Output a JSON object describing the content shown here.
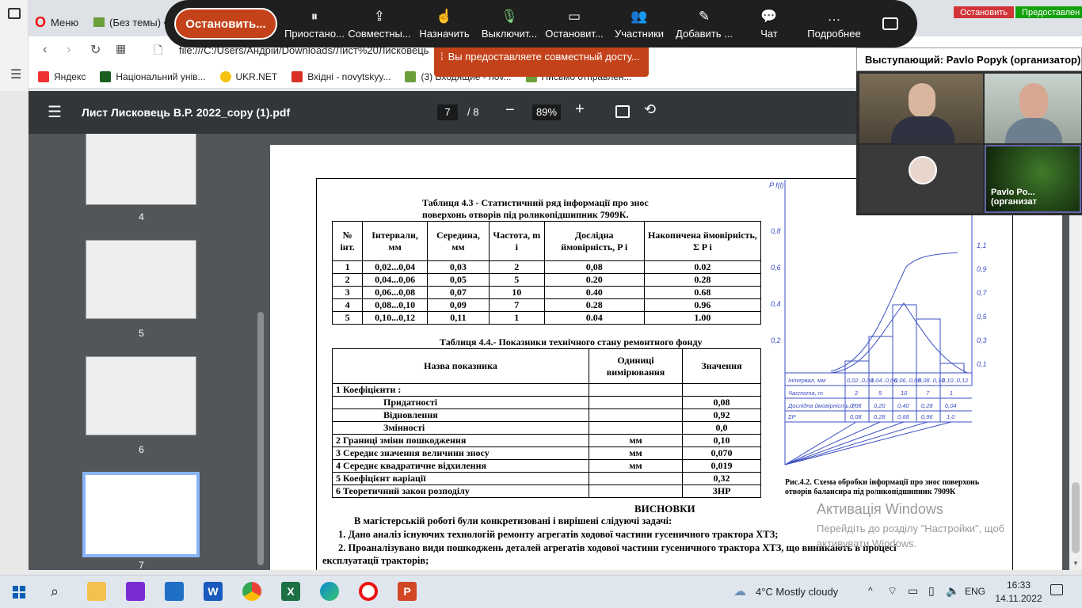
{
  "browser": {
    "tab1": "Меню",
    "tab2": "(Без темы) •",
    "address": "file:///C:/Users/Андрій/Downloads/Лист%20Лисковець",
    "bookmarks": [
      {
        "label": "Яндекс",
        "color": "#e33"
      },
      {
        "label": "Національний унів...",
        "color": "#1b5e20"
      },
      {
        "label": "UKR.NET",
        "color": "#f4c20d"
      },
      {
        "label": "Вхідні - novytskyy...",
        "color": "#d93025"
      },
      {
        "label": "(3) Входящие - nov...",
        "color": "#6a9f3a"
      },
      {
        "label": "Письмо отправлен...",
        "color": "#6a9f3a"
      }
    ]
  },
  "teams": {
    "stop_label": "Остановить...",
    "buttons": [
      {
        "icon": "pause-icon",
        "glyph": "⏸",
        "label": "Приостано..."
      },
      {
        "icon": "share-screen-icon",
        "glyph": "⇪",
        "label": "Совместны..."
      },
      {
        "icon": "assign-icon",
        "glyph": "☝",
        "label": "Назначить"
      },
      {
        "icon": "microphone-icon",
        "glyph": "🎙",
        "label": "Выключит..."
      },
      {
        "icon": "camera-icon",
        "glyph": "▭",
        "label": "Остановит..."
      },
      {
        "icon": "participants-icon",
        "glyph": "👥",
        "label": "Участники"
      },
      {
        "icon": "annotate-icon",
        "glyph": "✎",
        "label": "Добавить ..."
      },
      {
        "icon": "chat-icon",
        "glyph": "💬",
        "label": "Чат"
      },
      {
        "icon": "more-icon",
        "glyph": "…",
        "label": "Подробнее"
      }
    ],
    "share_banner": "Вы предоставляете совместный досту...",
    "top_stop": "Остановить",
    "top_share": "Предоставлен",
    "speaker_prefix": "Выступающий:",
    "speaker_name": "Pavlo Popyk (организатор)",
    "tile_name": "Pavlo Po... (организат"
  },
  "pdf": {
    "title": "Лист Лисковець В.Р. 2022_copy (1).pdf",
    "page_current": "7",
    "page_total": "/ 8",
    "zoom": "89%",
    "thumbs": [
      "4",
      "5",
      "6",
      "7"
    ]
  },
  "doc": {
    "table43_title1": "Таблиця 4.3 -  Статистичний ряд інформації про знос",
    "table43_title2": "поверхонь отворів під  роликопідшипник 7909К.",
    "table43_headers": [
      "№ інт.",
      "Інтервали, мм",
      "Середина, мм",
      "Частота, m i",
      "Дослідна ймовірність, P i",
      "Накопичена ймовірність, Σ P i"
    ],
    "table43_rows": [
      [
        "1",
        "0,02...0,04",
        "0,03",
        "2",
        "0,08",
        "0.02"
      ],
      [
        "2",
        "0,04...0,06",
        "0,05",
        "5",
        "0.20",
        "0.28"
      ],
      [
        "3",
        "0,06...0,08",
        "0,07",
        "10",
        "0.40",
        "0.68"
      ],
      [
        "4",
        "0,08...0,10",
        "0,09",
        "7",
        "0.28",
        "0.96"
      ],
      [
        "5",
        "0,10...0,12",
        "0,11",
        "1",
        "0.04",
        "1.00"
      ]
    ],
    "table44_title": "Таблиця 4.4.- Показники технічного стану ремонтного фонду",
    "table44_headers": [
      "Назва показника",
      "Одиниці вимірювання",
      "Значення"
    ],
    "table44_rows": [
      [
        "1  Коефіцієнти :",
        "",
        ""
      ],
      [
        "Придатності",
        "",
        "0,08"
      ],
      [
        "Відновлення",
        "",
        "0,92"
      ],
      [
        "Змінності",
        "",
        "0,0"
      ],
      [
        "2  Границі зміни пошкодження",
        "мм",
        "0,10"
      ],
      [
        "3  Середнє значення величини зносу",
        "мм",
        "0,070"
      ],
      [
        "4  Середнє квадратичне відхилення",
        "мм",
        "0,019"
      ],
      [
        "5   Коефіцієнт варіації",
        "",
        "0,32"
      ],
      [
        "6  Теоретичний закон розподілу",
        "",
        "ЗНР"
      ]
    ],
    "fig_caption1": "Рис.4.2. Схема обробки інформації про знос поверхонь",
    "fig_caption2": "отворів балансира під роликопідшипник 7909К",
    "conclusions_title": "ВИСНОВКИ",
    "conclusions_intro": "В магістерській  роботі були конкретизовані  і вирішені слідуючі задачі:",
    "conclusion1": "1.   Дано аналіз існуючих технологій ремонту агрегатів ходової частини гусеничного трактора ХТЗ;",
    "conclusion2a": "2. Проаналізувано  види пошкоджень деталей агрегатів ходової частини гусеничного трактора ХТЗ, що виникають в процесі",
    "conclusion2b": "експлуатації тракторів;",
    "graph_rows": [
      [
        "Інтервал, мм",
        "0,02..0,04",
        "0,04..0,06",
        "0,06..0,08",
        "0,08..0,10",
        "0,10..0,12"
      ],
      [
        "Частота, m",
        "2",
        "5",
        "10",
        "7",
        "1"
      ],
      [
        "Дослідна ймовірність, P",
        "0,08",
        "0,20",
        "0,40",
        "0,28",
        "0,04"
      ],
      [
        "ΣP",
        "0,08",
        "0,28",
        "0,68",
        "0,96",
        "1,0"
      ]
    ],
    "graph_left_ticks": [
      "0,8",
      "0,6",
      "0,4",
      "0,2"
    ],
    "graph_right_ticks": [
      "1,1",
      "0,9",
      "0,7",
      "0,5",
      "0,3",
      "0,1"
    ],
    "graph_axis_label": "P f(l)"
  },
  "watermark": {
    "title": "Активація Windows",
    "line1": "Перейдіть до розділу \"Настройки\", щоб",
    "line2": "активувати Windows."
  },
  "taskbar": {
    "weather": "4°C  Mostly cloudy",
    "lang": "ENG",
    "time": "16:33",
    "date": "14.11.2022"
  }
}
